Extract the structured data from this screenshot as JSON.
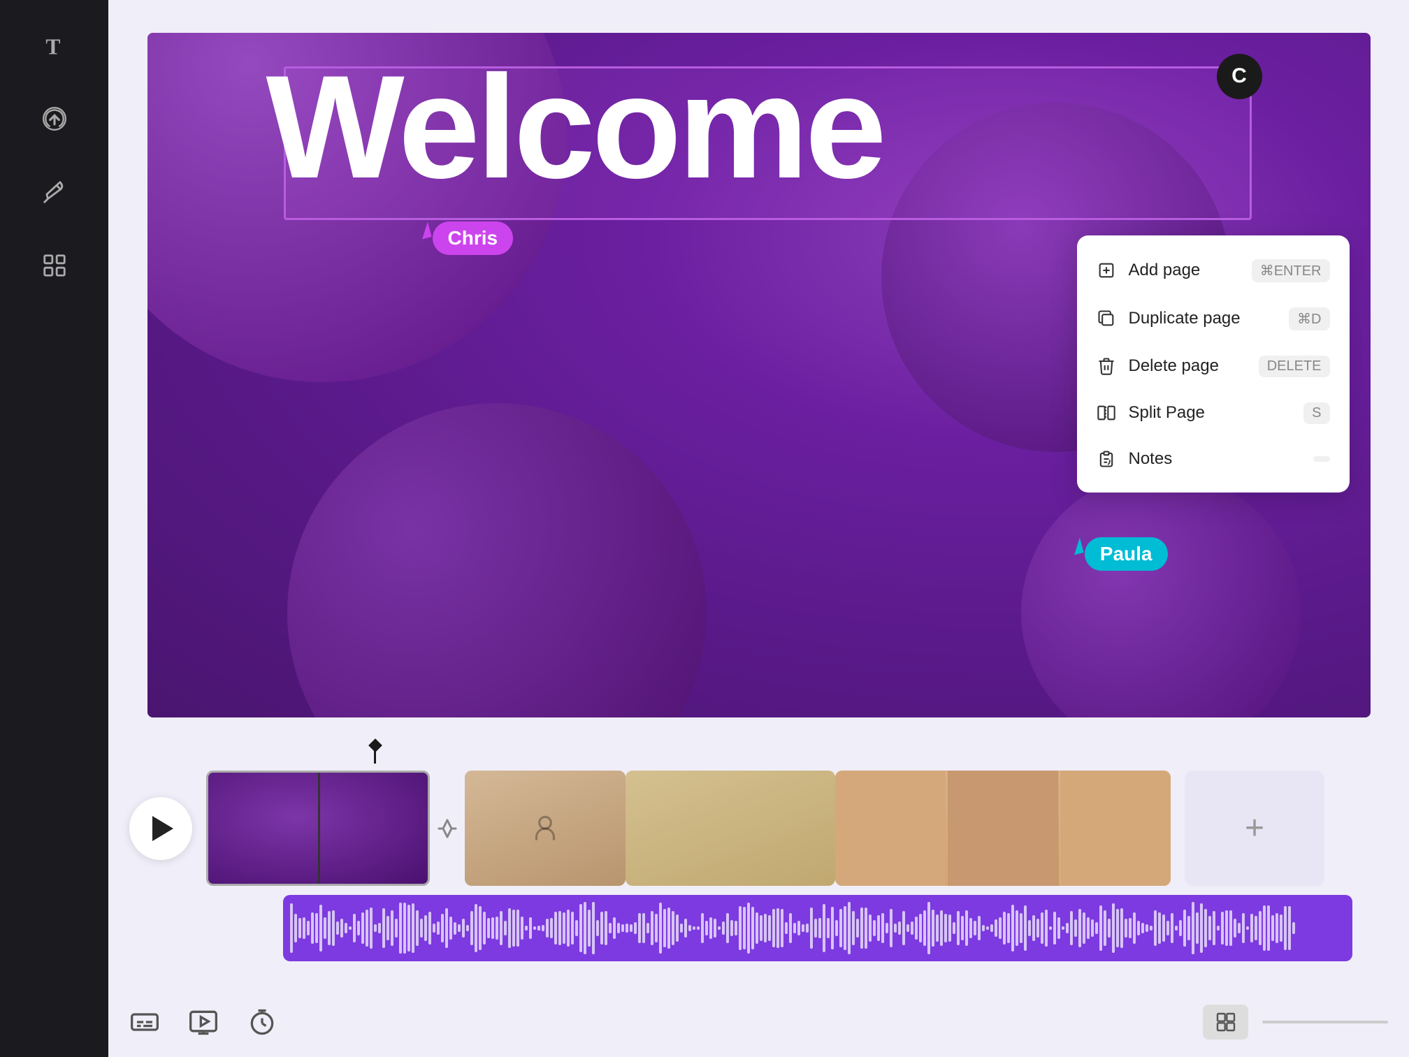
{
  "sidebar": {
    "icons": [
      {
        "name": "text-icon",
        "label": "T"
      },
      {
        "name": "upload-icon",
        "label": "upload"
      },
      {
        "name": "pen-icon",
        "label": "pen"
      },
      {
        "name": "grid-icon",
        "label": "grid"
      }
    ]
  },
  "canvas": {
    "welcome_text": "Welcome",
    "c_avatar": "C",
    "chris_label": "Chris",
    "paula_label": "Paula"
  },
  "context_menu": {
    "items": [
      {
        "name": "add-page",
        "label": "Add page",
        "shortcut": "⌘ENTER",
        "icon": "add-page-icon"
      },
      {
        "name": "duplicate-page",
        "label": "Duplicate page",
        "shortcut": "⌘D",
        "icon": "duplicate-page-icon"
      },
      {
        "name": "delete-page",
        "label": "Delete page",
        "shortcut": "DELETE",
        "icon": "delete-page-icon"
      },
      {
        "name": "split-page",
        "label": "Split Page",
        "shortcut": "S",
        "icon": "split-page-icon"
      },
      {
        "name": "notes",
        "label": "Notes",
        "shortcut": "",
        "icon": "notes-icon"
      }
    ]
  },
  "timeline": {
    "add_button_label": "+",
    "clips": [
      {
        "name": "clip-1",
        "type": "video"
      },
      {
        "name": "clip-2",
        "type": "video"
      },
      {
        "name": "clip-3",
        "type": "video"
      },
      {
        "name": "clip-4",
        "type": "video"
      }
    ]
  },
  "bottom_toolbar": {
    "tools": [
      {
        "name": "captions-icon",
        "label": "captions"
      },
      {
        "name": "preview-icon",
        "label": "preview"
      },
      {
        "name": "timer-icon",
        "label": "timer"
      }
    ]
  },
  "colors": {
    "accent_purple": "#b85de0",
    "accent_cyan": "#00bcd4",
    "sidebar_bg": "#1a1a1f",
    "canvas_bg": "#6b2fa0",
    "audio_bg": "#7c3ae0"
  }
}
